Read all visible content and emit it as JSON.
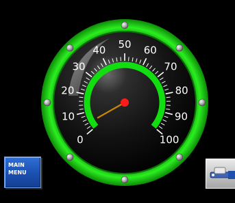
{
  "gauge": {
    "min": 0,
    "max": 100,
    "value": 4,
    "labels": [
      "0",
      "10",
      "20",
      "30",
      "40",
      "50",
      "60",
      "70",
      "80",
      "90",
      "100"
    ],
    "colors": {
      "bezel": "#22e01a",
      "bezel_dark": "#109a0c",
      "face": "#151515",
      "arc": "#11dd11",
      "needle": "#cc8800",
      "hub": "#ff1a1a",
      "ticks": "#ffffff"
    }
  },
  "main_menu": {
    "line1": "MAIN",
    "line2": "MENU",
    "color": "#1f58c2"
  },
  "side_button": {
    "icon": "wrench-icon"
  }
}
